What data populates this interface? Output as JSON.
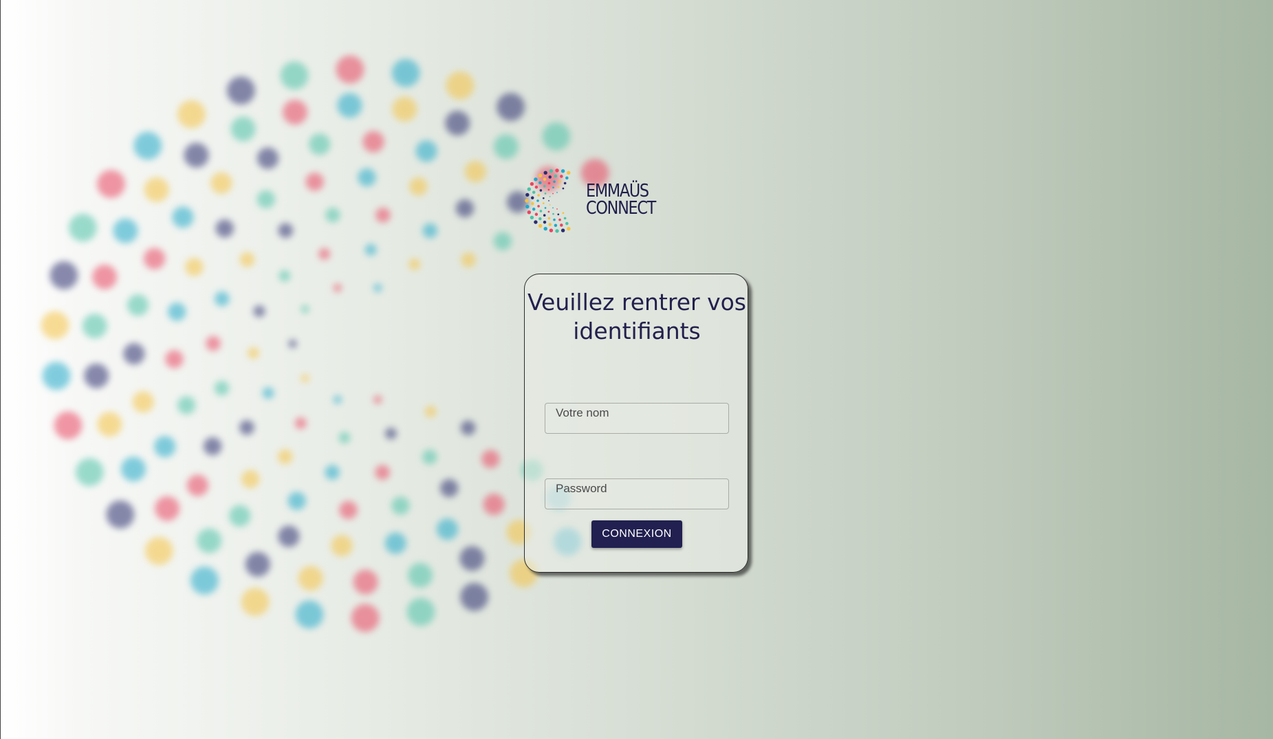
{
  "logo": {
    "line1": "EMMAÜS",
    "line2": "CONNECT",
    "colors": [
      "#e94560",
      "#1fa8c9",
      "#f5c242",
      "#2b2d6e",
      "#4cc2a8"
    ]
  },
  "login": {
    "title": "Veuillez rentrer vos identifiants",
    "name_placeholder": "Votre nom",
    "password_placeholder": "Password",
    "submit_label": "CONNEXION"
  },
  "theme": {
    "accent": "#212050",
    "title_color": "#23204d"
  }
}
